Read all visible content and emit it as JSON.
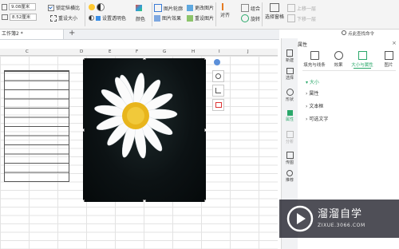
{
  "ribbon": {
    "height_label": "9.08厘米",
    "width_label": "8.52厘米",
    "lock_ratio": "锁定纵横比",
    "reset_size": "重设大小",
    "set_transparent": "设置透明色",
    "color": "颜色",
    "pic_outline": "图片轮廓",
    "pic_effect": "图片效果",
    "change_pic": "更改图片",
    "reset_pic": "重设图片",
    "align": "对齐",
    "rotate": "旋转",
    "group": "组合",
    "select_pane": "选择窗格",
    "bring_up": "上移一层",
    "send_down": "下移一层"
  },
  "sheet": {
    "tab_label": "工作簿2 *",
    "add_tab": "+",
    "columns": [
      "C",
      "D",
      "E",
      "F",
      "G",
      "H",
      "I",
      "J"
    ]
  },
  "right_strip": [
    {
      "label": "新建",
      "icon": "new-icon"
    },
    {
      "label": "选择",
      "icon": "select-icon"
    },
    {
      "label": "形状",
      "icon": "shape-icon"
    },
    {
      "label": "属性",
      "icon": "property-icon"
    },
    {
      "label": "分析",
      "icon": "analysis-icon"
    },
    {
      "label": "传图",
      "icon": "upload-icon"
    },
    {
      "label": "推荐",
      "icon": "recommend-icon"
    }
  ],
  "pane": {
    "search": "点此查找命令",
    "title": "属性",
    "tabs": [
      "填充与线条",
      "效果",
      "大小与属性",
      "图片"
    ],
    "active_tab_index": 2,
    "sections": [
      "大小",
      "属性",
      "文本框",
      "可选文字"
    ]
  },
  "watermark": {
    "text": "溜溜自学",
    "url": "ZIXUE.3066.COM"
  },
  "colors": {
    "accent": "#2aa86a",
    "ribbon_bg": "#f4f4f4"
  }
}
